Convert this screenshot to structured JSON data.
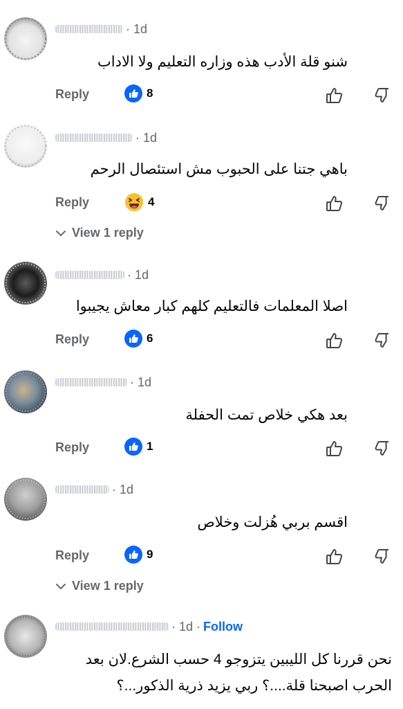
{
  "comments": [
    {
      "time": "· 1d",
      "text": "شنو قلة الأدب هذه وزاره التعليم ولا الاداب",
      "reply_label": "Reply",
      "reaction_icon": "like-reaction-icon",
      "reaction_count": "8"
    },
    {
      "time": "· 1d",
      "text": "باهي جتنا على الحبوب مش استئصال الرحم",
      "reply_label": "Reply",
      "reaction_icon": "haha-reaction-icon",
      "reaction_count": "4",
      "view_replies": "View 1 reply"
    },
    {
      "time": "· 1d",
      "text": "اصلا المعلمات فالتعليم كلهم كبار معاش يجيبوا",
      "reply_label": "Reply",
      "reaction_icon": "like-reaction-icon",
      "reaction_count": "6"
    },
    {
      "time": "· 1d",
      "text": "بعد هكي خلاص تمت الحفلة",
      "reply_label": "Reply",
      "reaction_icon": "like-reaction-icon",
      "reaction_count": "1"
    },
    {
      "time": "· 1d",
      "text": "اقسم بربي هُزلت وخلاص",
      "reply_label": "Reply",
      "reaction_icon": "like-reaction-icon",
      "reaction_count": "9",
      "view_replies": "View 1 reply"
    },
    {
      "time": "· 1d ·",
      "follow_label": "Follow",
      "text": "نحن قررنا كل الليبين يتزوجو 4 حسب الشرع.لان بعد الحرب اصبحنا قلة....؟ ربي يزيد ذرية الذكور...؟"
    }
  ],
  "colors": {
    "facebook_blue": "#0866ff",
    "secondary_text": "#65676b",
    "primary_text": "#050505"
  }
}
